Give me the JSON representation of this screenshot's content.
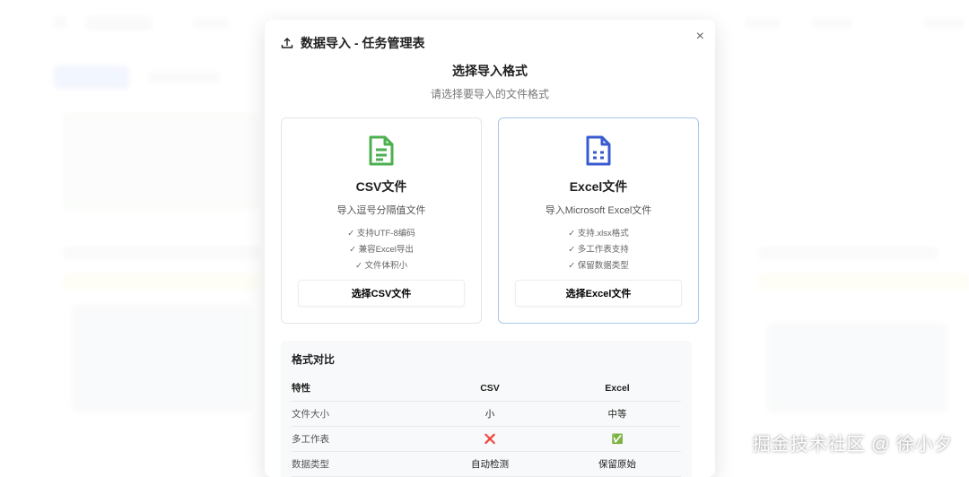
{
  "modal": {
    "title": "数据导入 - 任务管理表",
    "heading": "选择导入格式",
    "subtitle": "请选择要导入的文件格式",
    "cards": [
      {
        "title": "CSV文件",
        "desc": "导入逗号分隔值文件",
        "features": [
          "✓ 支持UTF-8编码",
          "✓ 兼容Excel导出",
          "✓ 文件体积小"
        ],
        "button": "选择CSV文件",
        "icon": "file-text-icon",
        "color": "#4caf50"
      },
      {
        "title": "Excel文件",
        "desc": "导入Microsoft Excel文件",
        "features": [
          "✓ 支持.xlsx格式",
          "✓ 多工作表支持",
          "✓ 保留数据类型"
        ],
        "button": "选择Excel文件",
        "icon": "spreadsheet-icon",
        "color": "#3a5bd0"
      }
    ],
    "comparison": {
      "title": "格式对比",
      "headers": [
        "特性",
        "CSV",
        "Excel"
      ],
      "rows": [
        [
          "文件大小",
          "小",
          "中等"
        ],
        [
          "多工作表",
          "❌",
          "✅"
        ],
        [
          "数据类型",
          "自动检测",
          "保留原始"
        ]
      ]
    }
  },
  "watermark": "掘金技术社区 @ 徐小夕"
}
